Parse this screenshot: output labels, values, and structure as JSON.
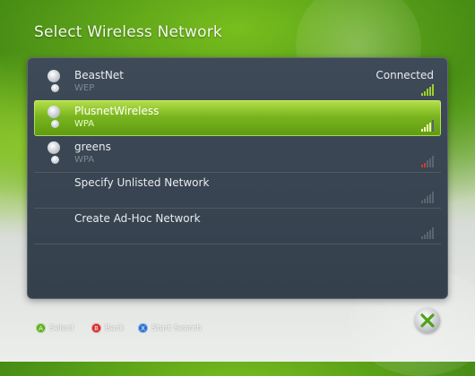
{
  "header": {
    "title": "Select Wireless Network"
  },
  "networks": [
    {
      "name": "BeastNet",
      "security": "WEP",
      "status": "Connected",
      "signal_bars": 5,
      "signal_color": "#9bd12a",
      "selected": false,
      "has_icon": true
    },
    {
      "name": "PlusnetWireless",
      "security": "WPA",
      "status": "",
      "signal_bars": 4,
      "signal_color": "#f0ffb0",
      "selected": true,
      "has_icon": true
    },
    {
      "name": "greens",
      "security": "WPA",
      "status": "",
      "signal_bars": 2,
      "signal_color": "#d23a2a",
      "selected": false,
      "has_icon": true
    },
    {
      "name": "Specify Unlisted Network",
      "security": "",
      "status": "",
      "signal_bars": 0,
      "signal_color": "#5a6570",
      "selected": false,
      "has_icon": false
    },
    {
      "name": "Create Ad-Hoc Network",
      "security": "",
      "status": "",
      "signal_bars": 0,
      "signal_color": "#5a6570",
      "selected": false,
      "has_icon": false
    }
  ],
  "footer": {
    "select": {
      "glyph": "A",
      "label": "Select",
      "color": "#5fae1f"
    },
    "back": {
      "glyph": "B",
      "label": "Back",
      "color": "#d22a2a"
    },
    "search": {
      "glyph": "X",
      "label": "Start Search",
      "color": "#2d6fd0"
    }
  },
  "colors": {
    "accent": "#7ab51f",
    "panel": "#3a4552"
  },
  "icons": {
    "logo": "xbox-logo-icon"
  }
}
